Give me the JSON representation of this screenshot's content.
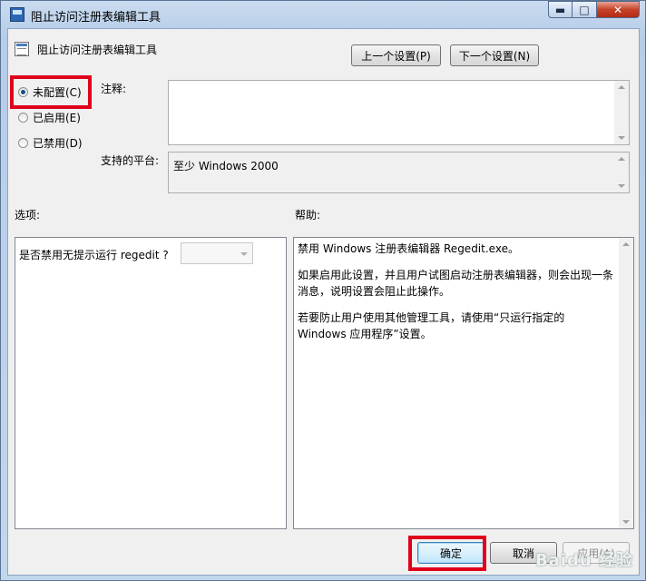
{
  "window": {
    "title": "阻止访问注册表编辑工具",
    "min_glyph": "▬",
    "max_glyph": "□",
    "close_glyph": "✕"
  },
  "header": {
    "policy_name": "阻止访问注册表编辑工具",
    "prev_button": "上一个设置(P)",
    "next_button": "下一个设置(N)"
  },
  "state": {
    "options": [
      {
        "label": "未配置(C)",
        "checked": true
      },
      {
        "label": "已启用(E)",
        "checked": false
      },
      {
        "label": "已禁用(D)",
        "checked": false
      }
    ]
  },
  "comment": {
    "label": "注释:",
    "value": ""
  },
  "platform": {
    "label": "支持的平台:",
    "value": "至少 Windows 2000"
  },
  "options_panel": {
    "label": "选项:",
    "question": "是否禁用无提示运行 regedit ?",
    "select_value": ""
  },
  "help_panel": {
    "label": "帮助:",
    "paragraphs": [
      "禁用 Windows 注册表编辑器 Regedit.exe。",
      "如果启用此设置，并且用户试图启动注册表编辑器，则会出现一条消息，说明设置会阻止此操作。",
      "若要防止用户使用其他管理工具，请使用“只运行指定的 Windows 应用程序”设置。"
    ]
  },
  "footer": {
    "ok": "确定",
    "cancel": "取消",
    "apply": "应用(A)"
  },
  "watermark": {
    "text": "Baidu 经验"
  },
  "colors": {
    "highlight": "#e0001b",
    "title_bar": "#b6cde8"
  }
}
